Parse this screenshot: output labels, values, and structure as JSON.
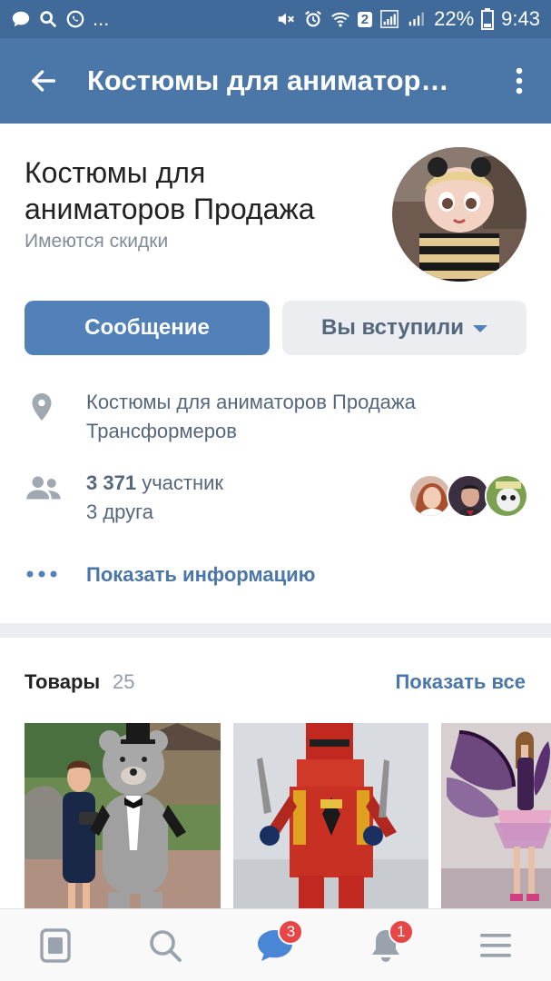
{
  "statusbar": {
    "sim_badge": "2",
    "battery": "22%",
    "time": "9:43",
    "dots": "..."
  },
  "toolbar": {
    "title": "Костюмы для аниматоров...",
    "back_icon": "arrow-left-icon",
    "more_icon": "more-vertical-icon"
  },
  "group": {
    "name": "Костюмы для аниматоров Продажа",
    "status": "Имеются скидки",
    "message_button": "Сообщение",
    "joined_button": "Вы вступили",
    "address_line1": "Костюмы для аниматоров Продажа",
    "address_line2": "Трансформеров",
    "members_count": "3 371",
    "members_label": "участник",
    "friends": "3 друга",
    "show_info": "Показать информацию"
  },
  "goods": {
    "title": "Товары",
    "count": "25",
    "show_all": "Показать все"
  },
  "tabbar": {
    "messages_badge": "3",
    "notifications_badge": "1"
  },
  "colors": {
    "header": "#4a76a8",
    "statusbar": "#3f6a99",
    "accent": "#5181b8",
    "badge": "#e64646"
  }
}
